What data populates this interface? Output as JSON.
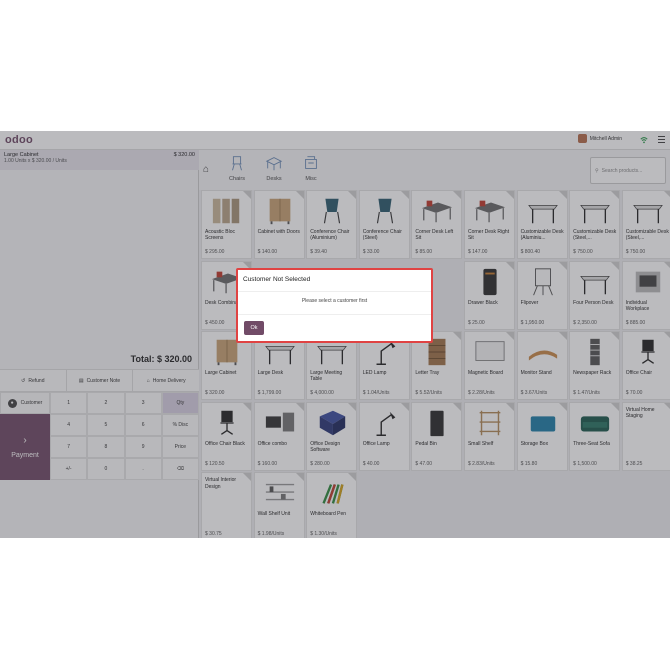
{
  "app": {
    "logo": "odoo",
    "user_name": "Mitchell Admin"
  },
  "order": {
    "line": {
      "name": "Large Cabinet",
      "price": "$ 320.00",
      "detail": "1.00  Units x $ 320.00 / Units"
    },
    "total": "Total: $ 320.00"
  },
  "actions": [
    {
      "label": "Refund",
      "icon": "refund-icon"
    },
    {
      "label": "Customer Note",
      "icon": "note-icon"
    },
    {
      "label": "Home Delivery",
      "icon": "home-icon"
    }
  ],
  "pad": {
    "customer": "Customer",
    "payment": "Payment",
    "keys": [
      "1",
      "2",
      "3",
      "Qty",
      "4",
      "5",
      "6",
      "% Disc",
      "7",
      "8",
      "9",
      "Price",
      "+/-",
      "0",
      ".",
      "⌫"
    ]
  },
  "categories": [
    {
      "label": "Chairs"
    },
    {
      "label": "Desks"
    },
    {
      "label": "Misc"
    }
  ],
  "search": {
    "placeholder": "Search products..."
  },
  "products": [
    {
      "name": "Acoustic Bloc Screens",
      "price": "$ 295.00",
      "icon": "screens"
    },
    {
      "name": "Cabinet with Doors",
      "price": "$ 140.00",
      "icon": "cabinet"
    },
    {
      "name": "Conference Chair (Aluminium)",
      "price": "$ 39.40",
      "icon": "chair"
    },
    {
      "name": "Conference Chair (Steel)",
      "price": "$ 33.00",
      "icon": "chair"
    },
    {
      "name": "Corner Desk Left Sit",
      "price": "$ 85.00",
      "icon": "desk"
    },
    {
      "name": "Corner Desk Right Sit",
      "price": "$ 147.00",
      "icon": "desk"
    },
    {
      "name": "Customizable Desk (Aluminiu...",
      "price": "$ 800.40",
      "icon": "table"
    },
    {
      "name": "Customizable Desk (Steel,...",
      "price": "$ 750.00",
      "icon": "table"
    },
    {
      "name": "Customizable Desk (Steel,...",
      "price": "$ 750.00",
      "icon": "table"
    },
    {
      "name": "Desk Combination",
      "price": "$ 450.00",
      "icon": "desk"
    },
    {
      "name": "",
      "price": "",
      "icon": "hidden"
    },
    {
      "name": "",
      "price": "",
      "icon": "hidden"
    },
    {
      "name": "",
      "price": "",
      "icon": "hidden"
    },
    {
      "name": "",
      "price": "",
      "icon": "hidden"
    },
    {
      "name": "Drawer Black",
      "price": "$ 25.00",
      "icon": "drawer"
    },
    {
      "name": "Flipover",
      "price": "$ 1,950.00",
      "icon": "flipover"
    },
    {
      "name": "Four Person Desk",
      "price": "$ 2,350.00",
      "icon": "table"
    },
    {
      "name": "Individual Workplace",
      "price": "$ 885.00",
      "icon": "workplace"
    },
    {
      "name": "Large Cabinet",
      "price": "$ 320.00",
      "icon": "cabinet"
    },
    {
      "name": "Large Desk",
      "price": "$ 1,799.00",
      "icon": "table"
    },
    {
      "name": "Large Meeting Table",
      "price": "$ 4,000.00",
      "icon": "table"
    },
    {
      "name": "LED Lamp",
      "price": "$ 1.04/Units",
      "icon": "lamp"
    },
    {
      "name": "Letter Tray",
      "price": "$ 5.52/Units",
      "icon": "tray"
    },
    {
      "name": "Magnetic Board",
      "price": "$ 2.28/Units",
      "icon": "board"
    },
    {
      "name": "Monitor Stand",
      "price": "$ 3.67/Units",
      "icon": "stand"
    },
    {
      "name": "Newspaper Rack",
      "price": "$ 1.47/Units",
      "icon": "rack"
    },
    {
      "name": "Office Chair",
      "price": "$ 70.00",
      "icon": "office-chair"
    },
    {
      "name": "Office Chair Black",
      "price": "$ 120.50",
      "icon": "office-chair"
    },
    {
      "name": "Office combo",
      "price": "$ 160.00",
      "icon": "combo"
    },
    {
      "name": "Office Design Software",
      "price": "$ 280.00",
      "icon": "software"
    },
    {
      "name": "Office Lamp",
      "price": "$ 40.00",
      "icon": "lamp"
    },
    {
      "name": "Pedal Bin",
      "price": "$ 47.00",
      "icon": "bin"
    },
    {
      "name": "Small Shelf",
      "price": "$ 2.83/Units",
      "icon": "shelf"
    },
    {
      "name": "Storage Box",
      "price": "$ 15.80",
      "icon": "box"
    },
    {
      "name": "Three-Seat Sofa",
      "price": "$ 1,500.00",
      "icon": "sofa"
    },
    {
      "name": "Virtual Home Staging",
      "price": "$ 38.25",
      "icon": "none"
    },
    {
      "name": "Virtual Interior Design",
      "price": "$ 30.75",
      "icon": "none"
    },
    {
      "name": "Wall Shelf Unit",
      "price": "$ 1.98/Units",
      "icon": "wall-shelf"
    },
    {
      "name": "Whiteboard Pen",
      "price": "$ 1.30/Units",
      "icon": "pens"
    }
  ],
  "dialog": {
    "title": "Customer Not Selected",
    "body": "Please select a customer first",
    "ok": "Ok"
  },
  "colors": {
    "brand": "#714b67",
    "highlight": "#e04343"
  }
}
